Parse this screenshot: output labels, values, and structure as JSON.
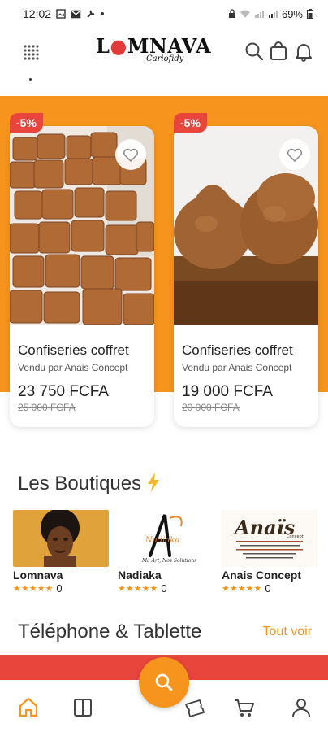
{
  "status_bar": {
    "time": "12:02",
    "battery": "69%"
  },
  "header": {
    "logo_text_a": "L",
    "logo_text_b": "MNAVA",
    "logo_sub": "Cariofidy"
  },
  "promo_cards": [
    {
      "badge": "-5%",
      "title": "Confiseries coffret",
      "seller": "Vendu par Anais Concept",
      "price": "23 750 FCFA",
      "old_price": "25 000 FCFA"
    },
    {
      "badge": "-5%",
      "title": "Confiseries coffret",
      "seller": "Vendu par Anais Concept",
      "price": "19 000 FCFA",
      "old_price": "20 000 FCFA"
    }
  ],
  "shops_section": {
    "title": "Les Boutiques",
    "shops": [
      {
        "name": "Lomnava",
        "rating": "0"
      },
      {
        "name": "Nadiaka",
        "rating": "0",
        "logo_text": "Nadiaka"
      },
      {
        "name": "Anais Concept",
        "rating": "0",
        "logo_text": "Anaïs"
      }
    ]
  },
  "category_section": {
    "title": "Téléphone & Tablette",
    "see_all": "Tout voir"
  },
  "colors": {
    "accent": "#f7941d",
    "red": "#e8453c"
  },
  "icons": [
    "grid-icon",
    "search-icon",
    "bag-icon",
    "bell-icon",
    "heart-icon",
    "lightning-icon",
    "home-icon",
    "catalog-icon",
    "tickets-icon",
    "cart-icon",
    "user-icon"
  ]
}
